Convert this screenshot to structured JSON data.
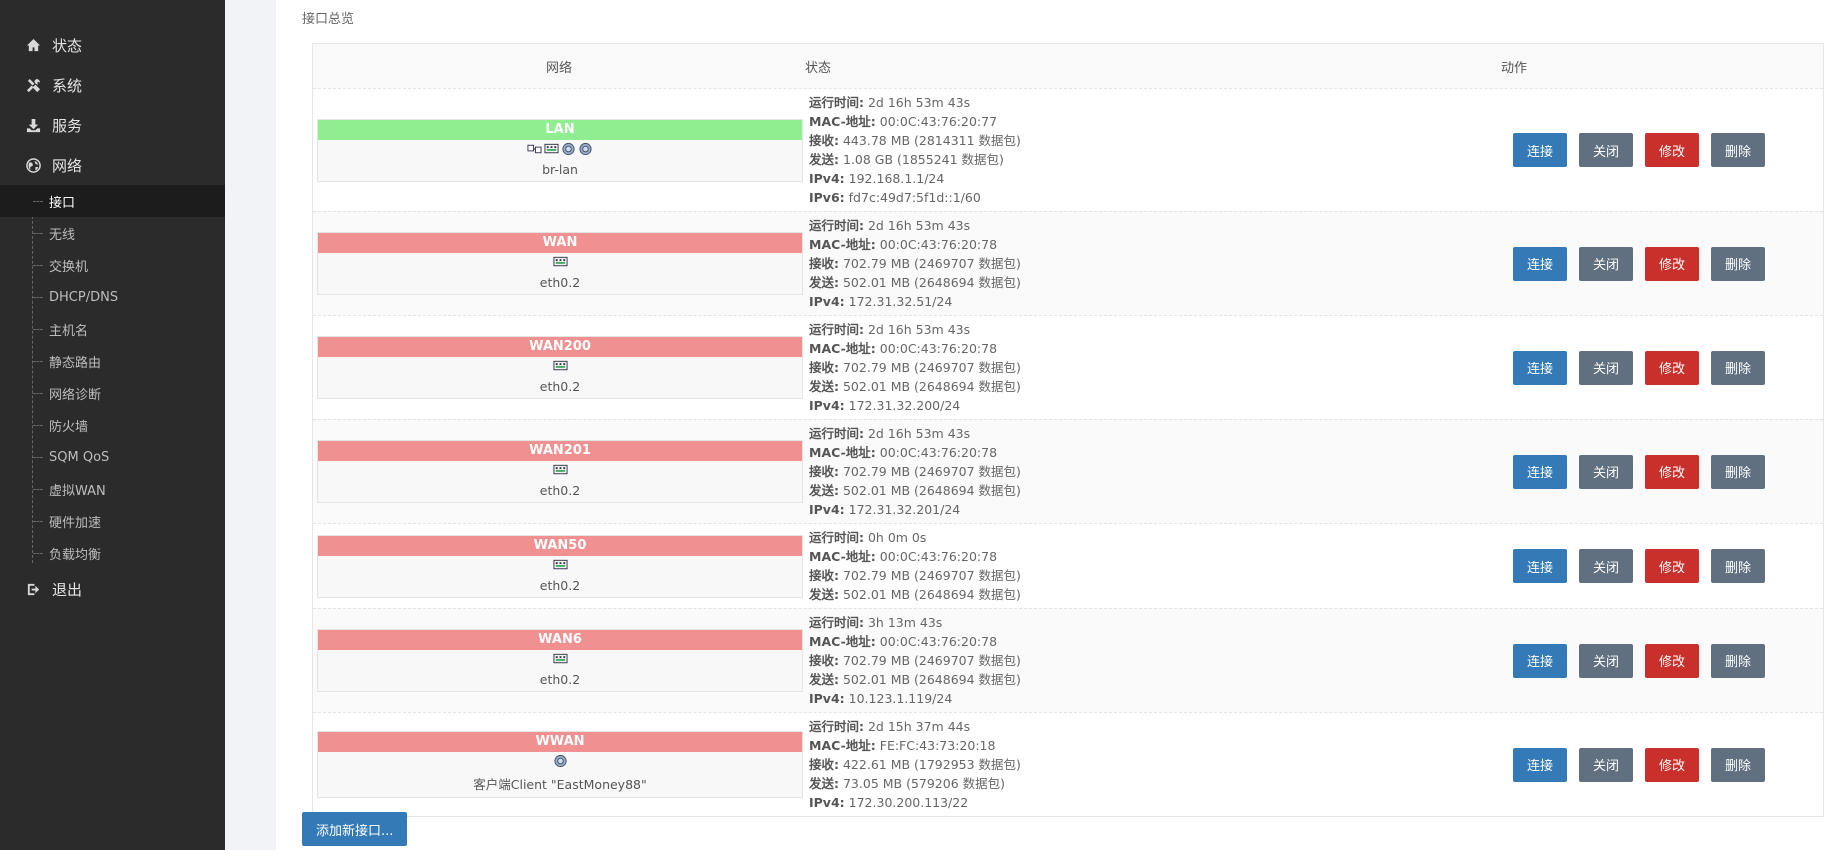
{
  "sidebar": {
    "top_items": [
      {
        "label": "状态",
        "icon": "home-icon"
      },
      {
        "label": "系统",
        "icon": "tools-icon"
      },
      {
        "label": "服务",
        "icon": "download-icon"
      },
      {
        "label": "网络",
        "icon": "globe-icon"
      }
    ],
    "sub_items": [
      {
        "label": "接口",
        "active": true
      },
      {
        "label": "无线"
      },
      {
        "label": "交换机"
      },
      {
        "label": "DHCP/DNS"
      },
      {
        "label": "主机名"
      },
      {
        "label": "静态路由"
      },
      {
        "label": "网络诊断"
      },
      {
        "label": "防火墙"
      },
      {
        "label": "SQM QoS"
      },
      {
        "label": "虚拟WAN"
      },
      {
        "label": "硬件加速"
      },
      {
        "label": "负载均衡"
      }
    ],
    "logout": {
      "label": "退出",
      "icon": "logout-icon"
    }
  },
  "section_title": "接口总览",
  "table": {
    "headers": {
      "network": "网络",
      "status": "状态",
      "actions": "动作"
    },
    "labels": {
      "uptime": "运行时间:",
      "mac": "MAC-地址:",
      "rx": "接收:",
      "tx": "发送:",
      "ipv4": "IPv4:",
      "ipv6": "IPv6:"
    },
    "buttons": {
      "connect": "连接",
      "close": "关闭",
      "edit": "修改",
      "delete": "删除"
    },
    "rows": [
      {
        "name": "LAN",
        "color": "#90ee90",
        "device": "br-lan",
        "uptime": "2d 16h 53m 43s",
        "mac": "00:0C:43:76:20:77",
        "rx": "443.78 MB (2814311 数据包)",
        "tx": "1.08 GB (1855241 数据包)",
        "ipv4": "192.168.1.1/24",
        "ipv6": "fd7c:49d7:5f1d::1/60"
      },
      {
        "name": "WAN",
        "color": "#f09090",
        "device": "eth0.2",
        "uptime": "2d 16h 53m 43s",
        "mac": "00:0C:43:76:20:78",
        "rx": "702.79 MB (2469707 数据包)",
        "tx": "502.01 MB (2648694 数据包)",
        "ipv4": "172.31.32.51/24"
      },
      {
        "name": "WAN200",
        "color": "#f09090",
        "device": "eth0.2",
        "uptime": "2d 16h 53m 43s",
        "mac": "00:0C:43:76:20:78",
        "rx": "702.79 MB (2469707 数据包)",
        "tx": "502.01 MB (2648694 数据包)",
        "ipv4": "172.31.32.200/24"
      },
      {
        "name": "WAN201",
        "color": "#f09090",
        "device": "eth0.2",
        "uptime": "2d 16h 53m 43s",
        "mac": "00:0C:43:76:20:78",
        "rx": "702.79 MB (2469707 数据包)",
        "tx": "502.01 MB (2648694 数据包)",
        "ipv4": "172.31.32.201/24"
      },
      {
        "name": "WAN50",
        "color": "#f09090",
        "device": "eth0.2",
        "uptime": "0h 0m 0s",
        "mac": "00:0C:43:76:20:78",
        "rx": "702.79 MB (2469707 数据包)",
        "tx": "502.01 MB (2648694 数据包)"
      },
      {
        "name": "WAN6",
        "color": "#f09090",
        "device": "eth0.2",
        "uptime": "3h 13m 43s",
        "mac": "00:0C:43:76:20:78",
        "rx": "702.79 MB (2469707 数据包)",
        "tx": "502.01 MB (2648694 数据包)",
        "ipv4": "10.123.1.119/24"
      },
      {
        "name": "WWAN",
        "color": "#f09090",
        "device": "客户端Client \"EastMoney88\"",
        "uptime": "2d 15h 37m 44s",
        "mac": "FE:FC:43:73:20:18",
        "rx": "422.61 MB (1792953 数据包)",
        "tx": "73.05 MB (579206 数据包)",
        "ipv4": "172.30.200.113/22"
      }
    ]
  },
  "add_button": "添加新接口..."
}
